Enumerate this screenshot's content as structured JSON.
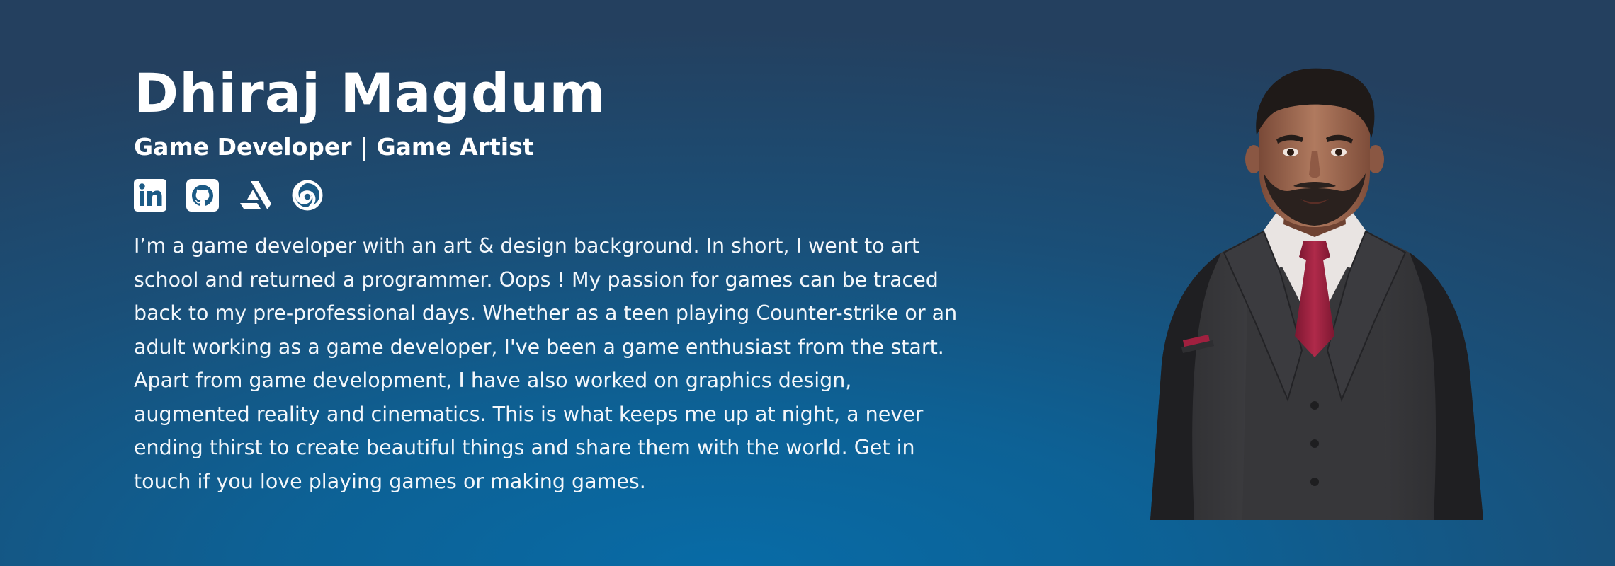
{
  "hero": {
    "name": "Dhiraj Magdum",
    "tagline": "Game Developer | Game Artist",
    "bio": "I’m a game developer with an art & design background. In short, I went to art school and returned a programmer. Oops ! My passion for games can be traced back to my pre-professional days. Whether as a teen playing Counter-strike or an adult working as a game developer, I've been a game enthusiast from the start. Apart from game development, I have also worked on graphics design, augmented reality and cinematics. This is what keeps me up at night, a never ending thirst to create beautiful things and share them with the world. Get in touch if you love playing games or making games.",
    "socials": [
      {
        "icon": "linkedin-icon"
      },
      {
        "icon": "github-icon"
      },
      {
        "icon": "artstation-icon"
      },
      {
        "icon": "swirl-portfolio-icon"
      }
    ]
  },
  "colors": {
    "background_center": "#086ba6",
    "background_edge": "#24405f",
    "text": "#ffffff",
    "tie": "#a0203f"
  }
}
